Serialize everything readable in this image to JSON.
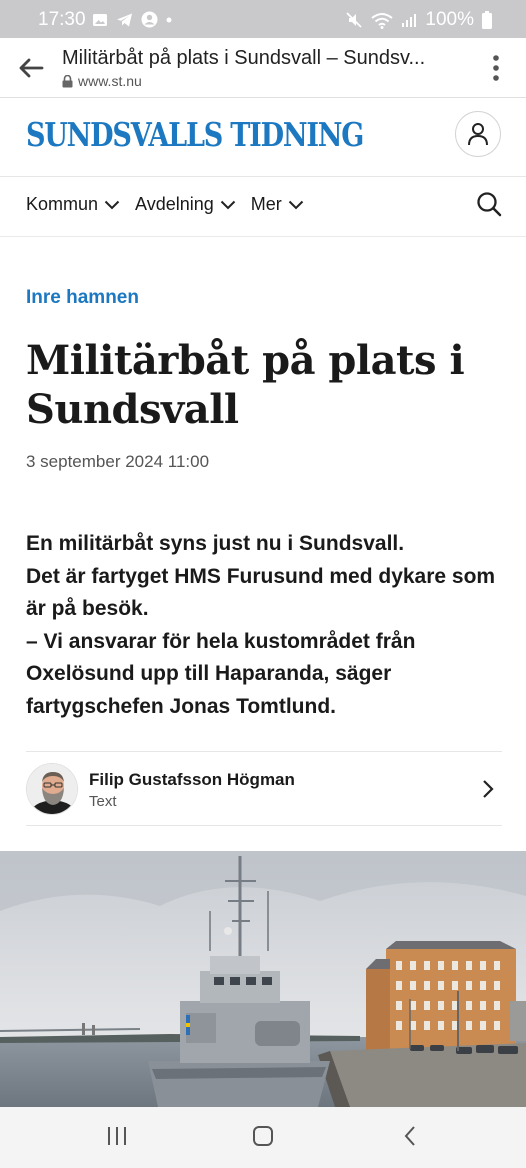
{
  "status_bar": {
    "time": "17:30",
    "battery": "100%"
  },
  "browser": {
    "tab_title": "Militärbåt på plats i Sundsvall – Sundsv...",
    "url": "www.st.nu"
  },
  "site": {
    "logo": "SUNDSVALLS TIDNING"
  },
  "nav": {
    "items": [
      {
        "label": "Kommun"
      },
      {
        "label": "Avdelning"
      },
      {
        "label": "Mer"
      }
    ]
  },
  "article": {
    "kicker": "Inre hamnen",
    "headline": "Militärbåt på plats i Sundsvall",
    "date": "3 september 2024 11:00",
    "lead": [
      "En militärbåt syns just nu i Sundsvall.",
      "Det är fartyget HMS Furusund med dykare som är på besök.",
      "– Vi ansvarar för hela kustområdet från Oxelösund upp till Haparanda, säger fartygschefen Jonas Tomtlund."
    ]
  },
  "byline": {
    "name": "Filip Gustafsson Högman",
    "role": "Text"
  },
  "colors": {
    "brand": "#1c78c0",
    "status_bar": "#c9c9cc"
  }
}
